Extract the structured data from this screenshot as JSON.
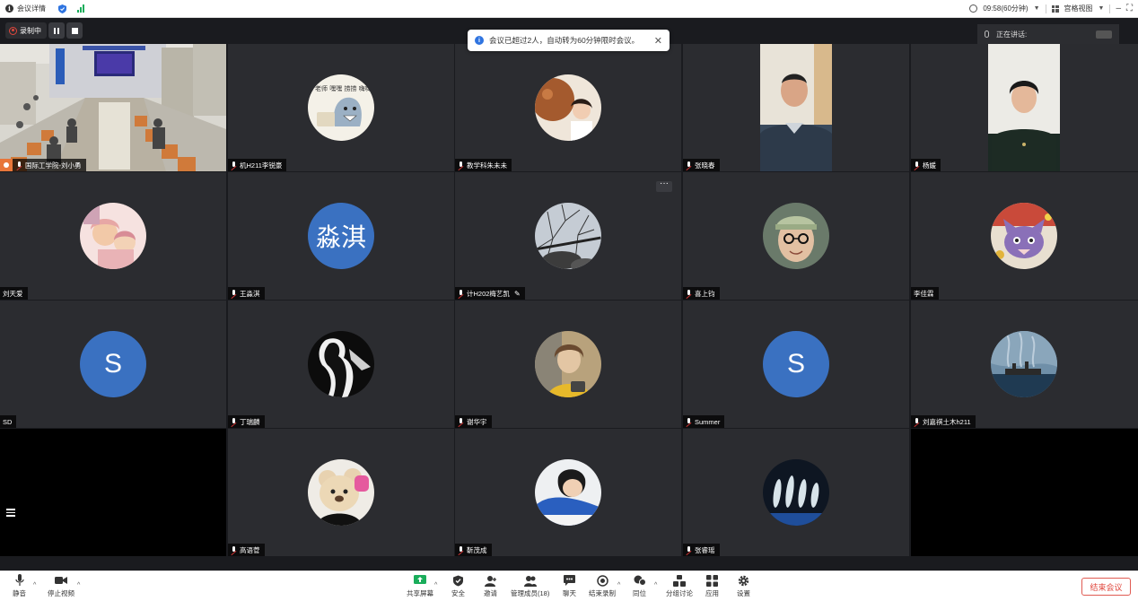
{
  "topbar": {
    "title": "会议详情",
    "time": "09:58(60分钟)",
    "view": "宫格视图"
  },
  "recording": {
    "label": "录制中"
  },
  "toast": {
    "message": "会议已超过2人，自动转为60分钟限时会议。"
  },
  "speaking": {
    "label": "正在讲话:"
  },
  "participants": [
    {
      "name": "国际工学院-刘小勇",
      "kind": "video",
      "host": true
    },
    {
      "name": "机H211李锐豪",
      "kind": "avatar"
    },
    {
      "name": "教学科朱未未",
      "kind": "avatar"
    },
    {
      "name": "张晓春",
      "kind": "portrait"
    },
    {
      "name": "杨媛",
      "kind": "portrait"
    },
    {
      "name": "刘天爱",
      "kind": "avatar"
    },
    {
      "name": "王淼淇",
      "kind": "initial",
      "initial": "淼淇"
    },
    {
      "name": "计H202梅艺凯",
      "kind": "avatar"
    },
    {
      "name": "喜上钧",
      "kind": "avatar"
    },
    {
      "name": "李佳霖",
      "kind": "avatar"
    },
    {
      "name": "SD",
      "kind": "initial",
      "initial": "S"
    },
    {
      "name": "丁瑞麟",
      "kind": "avatar"
    },
    {
      "name": "谢华宇",
      "kind": "avatar"
    },
    {
      "name": "Summer",
      "kind": "initial",
      "initial": "S"
    },
    {
      "name": "刘嘉祺土木h211",
      "kind": "avatar"
    },
    {
      "name": "高语菅",
      "kind": "avatar"
    },
    {
      "name": "靳茂成",
      "kind": "avatar"
    },
    {
      "name": "张睿瑶",
      "kind": "avatar"
    }
  ],
  "toolbar": {
    "mute": "静音",
    "stop_video": "停止视频",
    "share": "共享屏幕",
    "security": "安全",
    "invite": "邀请",
    "members": "管理成员(18)",
    "chat": "聊天",
    "end_record": "结束录制",
    "interpret": "同位",
    "breakout": "分组讨论",
    "apps": "应用",
    "settings": "设置",
    "end_meeting": "结束会议"
  },
  "colors": {
    "accent": "#2f74e0",
    "danger": "#e0463c",
    "avatar_blue": "#3a71c1",
    "tile": "#2b2c30"
  }
}
